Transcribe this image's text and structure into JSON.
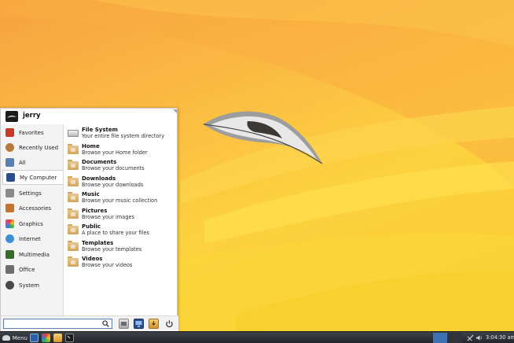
{
  "user": {
    "name": "jerry"
  },
  "categories": [
    {
      "label": "Favorites",
      "icon": "favorites-icon",
      "color": "#c83a2a"
    },
    {
      "label": "Recently Used",
      "icon": "recently-used-icon",
      "color": "#b77a3b"
    },
    {
      "label": "All",
      "icon": "all-apps-icon",
      "color": "#5b7fb0"
    },
    {
      "label": "My Computer",
      "icon": "computer-icon",
      "color": "#2c4f8c",
      "selected": true
    },
    {
      "label": "Settings",
      "icon": "settings-icon",
      "color": "#8a8a8a"
    },
    {
      "label": "Accessories",
      "icon": "accessories-icon",
      "color": "#c8732a"
    },
    {
      "label": "Graphics",
      "icon": "graphics-icon",
      "color": "#d04a9a"
    },
    {
      "label": "Internet",
      "icon": "internet-icon",
      "color": "#3f8fd6"
    },
    {
      "label": "Multimedia",
      "icon": "multimedia-icon",
      "color": "#3a6a2a"
    },
    {
      "label": "Office",
      "icon": "office-icon",
      "color": "#6d6d6d"
    },
    {
      "label": "System",
      "icon": "system-icon",
      "color": "#4a4a4a"
    }
  ],
  "places": [
    {
      "title": "File System",
      "desc": "Your entire file system directory",
      "icon": "drive-icon"
    },
    {
      "title": "Home",
      "desc": "Browse your Home folder",
      "icon": "home-folder-icon"
    },
    {
      "title": "Documents",
      "desc": "Browse your documents",
      "icon": "documents-folder-icon"
    },
    {
      "title": "Downloads",
      "desc": "Browse your downloads",
      "icon": "downloads-folder-icon"
    },
    {
      "title": "Music",
      "desc": "Browse your music collection",
      "icon": "music-folder-icon"
    },
    {
      "title": "Pictures",
      "desc": "Browse your images",
      "icon": "pictures-folder-icon"
    },
    {
      "title": "Public",
      "desc": "A place to share your files",
      "icon": "public-folder-icon"
    },
    {
      "title": "Templates",
      "desc": "Browse your templates",
      "icon": "templates-folder-icon"
    },
    {
      "title": "Videos",
      "desc": "Browse your videos",
      "icon": "videos-folder-icon"
    }
  ],
  "search": {
    "placeholder": "",
    "value": ""
  },
  "taskbar": {
    "menu_label": "Menu",
    "clock": "3:04:30 am",
    "accent": "#3f72b5"
  }
}
